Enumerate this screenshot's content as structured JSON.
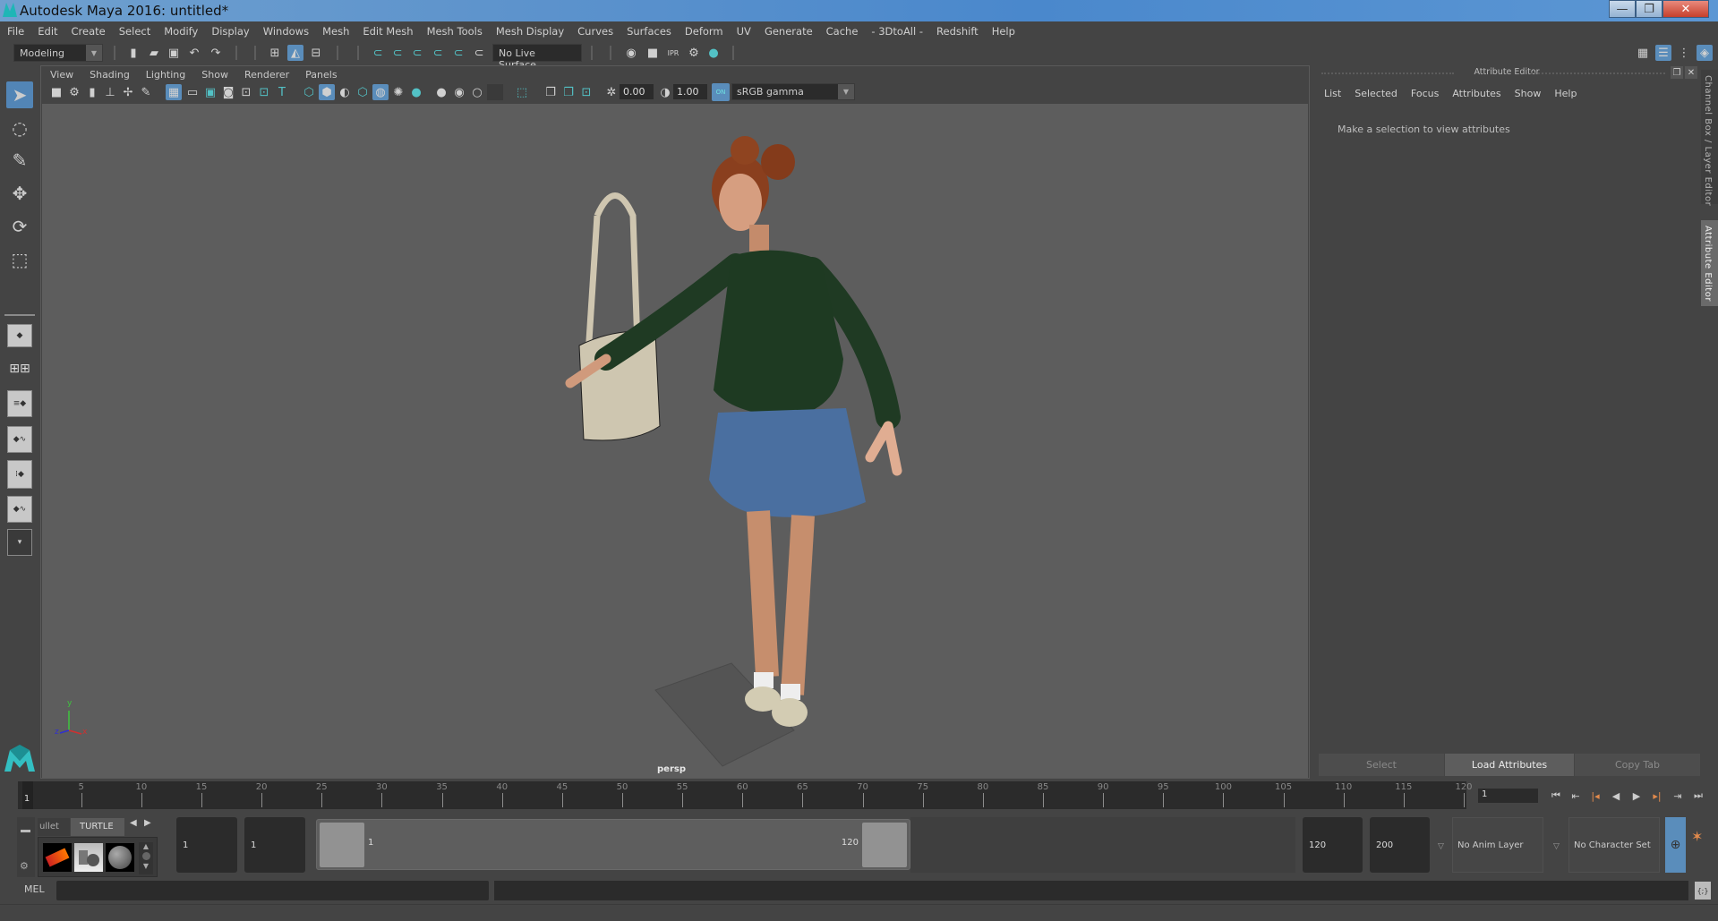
{
  "window": {
    "title": "Autodesk Maya 2016: untitled*",
    "controls": {
      "minimize": "—",
      "maximize": "❐",
      "close": "✕"
    }
  },
  "menubar": [
    "File",
    "Edit",
    "Create",
    "Select",
    "Modify",
    "Display",
    "Windows",
    "Mesh",
    "Edit Mesh",
    "Mesh Tools",
    "Mesh Display",
    "Curves",
    "Surfaces",
    "Deform",
    "UV",
    "Generate",
    "Cache",
    "- 3DtoAll -",
    "Redshift",
    "Help"
  ],
  "toolbar": {
    "menuset": "Modeling",
    "live_surface": "No Live Surface",
    "icons": [
      "new-scene",
      "open-scene",
      "save-scene",
      "undo",
      "redo",
      "select-by-hierarchy",
      "select-by-object",
      "select-by-component",
      "snap-grid",
      "snap-curve",
      "snap-point",
      "snap-view-plane",
      "snap-live",
      "make-live",
      "render-view",
      "render-current",
      "ipr-render",
      "render-settings",
      "hypershade"
    ]
  },
  "toolbox": {
    "tools": [
      "select-tool",
      "lasso-tool",
      "paint-select-tool",
      "move-tool",
      "rotate-tool",
      "scale-tool"
    ],
    "layouts": [
      "single-perspective",
      "four-view",
      "persp-outliner",
      "persp-graph",
      "hypershade-persp",
      "persp-graph-hypershade"
    ],
    "more": "▾"
  },
  "viewport": {
    "menu": [
      "View",
      "Shading",
      "Lighting",
      "Show",
      "Renderer",
      "Panels"
    ],
    "exposure": "0.00",
    "gamma": "1.00",
    "color_mgmt_toggle": "ON",
    "color_space": "sRGB gamma",
    "camera_label": "persp",
    "axis": {
      "x": "x",
      "y": "y",
      "z": "z"
    }
  },
  "attribute_editor": {
    "header": "Attribute Editor",
    "menu": [
      "List",
      "Selected",
      "Focus",
      "Attributes",
      "Show",
      "Help"
    ],
    "message": "Make a selection to view attributes",
    "buttons": {
      "select": "Select",
      "load": "Load Attributes",
      "copy": "Copy Tab"
    }
  },
  "side_tabs": {
    "channel_box": "Channel Box / Layer Editor",
    "attribute_editor": "Attribute Editor"
  },
  "timeline": {
    "start_marker": "1",
    "ticks": [
      "5",
      "10",
      "15",
      "20",
      "25",
      "30",
      "35",
      "40",
      "45",
      "50",
      "55",
      "60",
      "65",
      "70",
      "75",
      "80",
      "85",
      "90",
      "95",
      "100",
      "105",
      "110",
      "115",
      "120"
    ],
    "current_frame": "1",
    "playback": [
      "⏮",
      "⇤",
      "|◂",
      "◀",
      "▶",
      "▸|",
      "⇥",
      "⏭"
    ]
  },
  "shelf": {
    "tabs": [
      "ullet",
      "TURTLE"
    ],
    "active_tab": "TURTLE"
  },
  "range": {
    "anim_start": "1",
    "playback_start": "1",
    "slider_start": "1",
    "slider_end": "120",
    "playback_end": "120",
    "anim_end": "200",
    "anim_layer": "No Anim Layer",
    "character_set": "No Character Set"
  },
  "command_line": {
    "label": "MEL",
    "value": ""
  },
  "colors": {
    "accent": "#5285b6",
    "teal": "#53c2c6",
    "viewport_bg": "#5d5d5d",
    "panel_bg": "#444444"
  }
}
